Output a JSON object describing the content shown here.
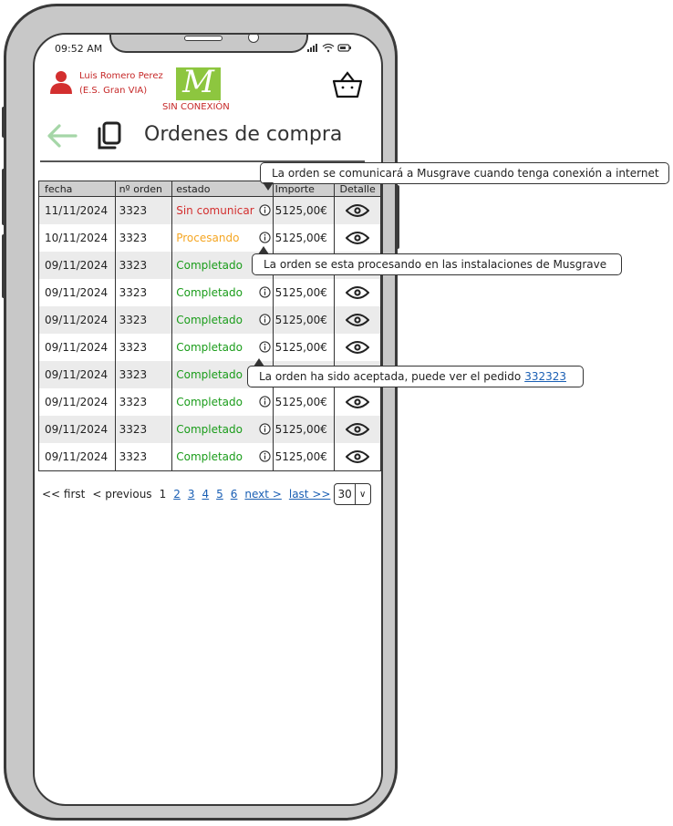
{
  "status_bar": {
    "time": "09:52 AM",
    "icons": "signal-wifi-battery"
  },
  "header": {
    "user_name": "Luis Romero Perez",
    "station": "(E.S. Gran VIA)",
    "logo_letter": "M",
    "connection_status": "SIN CONEXIÓN"
  },
  "page": {
    "title": "Ordenes de compra"
  },
  "table": {
    "columns": [
      "fecha",
      "nº orden",
      "estado",
      "Importe",
      "Detalle"
    ],
    "rows": [
      {
        "fecha": "11/11/2024",
        "orden": "3323",
        "estado": "Sin comunicar",
        "importe": "5125,00€",
        "status_class": "st-red"
      },
      {
        "fecha": "10/11/2024",
        "orden": "3323",
        "estado": "Procesando",
        "importe": "5125,00€",
        "status_class": "st-orange"
      },
      {
        "fecha": "09/11/2024",
        "orden": "3323",
        "estado": "Completado",
        "importe": "5125,00€",
        "status_class": "st-green"
      },
      {
        "fecha": "09/11/2024",
        "orden": "3323",
        "estado": "Completado",
        "importe": "5125,00€",
        "status_class": "st-green"
      },
      {
        "fecha": "09/11/2024",
        "orden": "3323",
        "estado": "Completado",
        "importe": "5125,00€",
        "status_class": "st-green"
      },
      {
        "fecha": "09/11/2024",
        "orden": "3323",
        "estado": "Completado",
        "importe": "5125,00€",
        "status_class": "st-green"
      },
      {
        "fecha": "09/11/2024",
        "orden": "3323",
        "estado": "Completado",
        "importe": "5125,00€",
        "status_class": "st-green"
      },
      {
        "fecha": "09/11/2024",
        "orden": "3323",
        "estado": "Completado",
        "importe": "5125,00€",
        "status_class": "st-green"
      },
      {
        "fecha": "09/11/2024",
        "orden": "3323",
        "estado": "Completado",
        "importe": "5125,00€",
        "status_class": "st-green"
      },
      {
        "fecha": "09/11/2024",
        "orden": "3323",
        "estado": "Completado",
        "importe": "5125,00€",
        "status_class": "st-green"
      }
    ]
  },
  "pager": {
    "first": "<< first",
    "previous": "< previous",
    "current": "1",
    "pages": [
      "2",
      "3",
      "4",
      "5",
      "6"
    ],
    "next": "next >",
    "last": "last >>",
    "page_size": "30"
  },
  "tooltips": {
    "not_sent": "La orden se comunicará a Musgrave cuando tenga conexión a internet",
    "processing": "La orden se esta procesando en las instalaciones de Musgrave",
    "accepted": "La orden ha sido aceptada, puede ver el pedido",
    "accepted_link": "332323"
  },
  "colors": {
    "accent_red": "#d32f2f",
    "processing": "#f5a623",
    "completed": "#1a9c1a",
    "logo_green": "#8dc63f",
    "back_arrow": "#a5d6a7"
  }
}
